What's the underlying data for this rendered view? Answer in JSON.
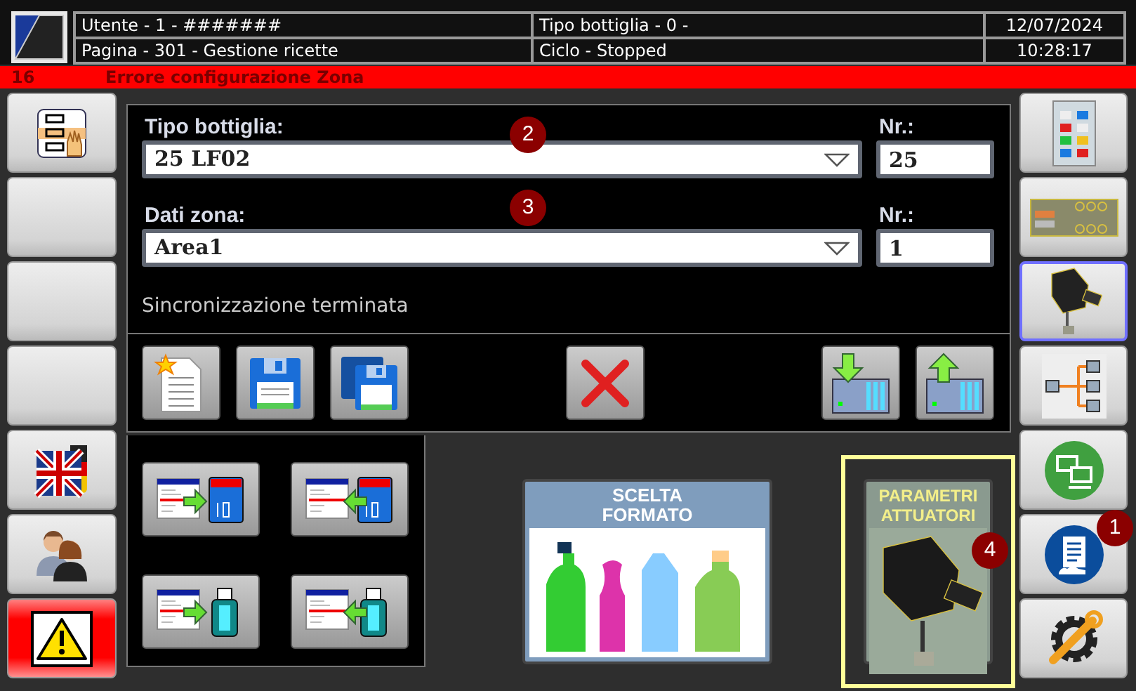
{
  "header": {
    "user": "Utente - 1 - #######",
    "bottle_type": "Tipo bottiglia - 0 -",
    "date": "12/07/2024",
    "page": "Pagina - 301 - Gestione ricette",
    "cycle": "Ciclo - Stopped",
    "time": "10:28:17"
  },
  "alarm": {
    "code": "16",
    "message": "Errore configurazione Zona"
  },
  "left_nav": [
    {
      "kind": "recipe",
      "selected": false
    },
    {
      "kind": "blank",
      "selected": false
    },
    {
      "kind": "blank",
      "selected": false
    },
    {
      "kind": "blank",
      "selected": false
    },
    {
      "kind": "language",
      "selected": false
    },
    {
      "kind": "users",
      "selected": false
    },
    {
      "kind": "alarm",
      "selected": false
    }
  ],
  "right_nav": [
    {
      "kind": "panel",
      "selected": false
    },
    {
      "kind": "board",
      "selected": false
    },
    {
      "kind": "actuator",
      "selected": true
    },
    {
      "kind": "tree",
      "selected": false
    },
    {
      "kind": "network",
      "selected": false
    },
    {
      "kind": "document",
      "selected": false,
      "badge": "1"
    },
    {
      "kind": "tools",
      "selected": false
    }
  ],
  "fields": [
    {
      "label": "Tipo bottiglia:",
      "value": "25 LF02",
      "nr_label": "Nr.:",
      "nr_value": "25",
      "badge": "2"
    },
    {
      "label": "Dati zona:",
      "value": "Area1",
      "nr_label": "Nr.:",
      "nr_value": "1",
      "badge": "3"
    }
  ],
  "status": "Sincronizzazione terminata",
  "toolbar": [
    {
      "kind": "new"
    },
    {
      "kind": "save"
    },
    {
      "kind": "save_as"
    },
    {
      "kind": "delete"
    },
    {
      "kind": "download"
    },
    {
      "kind": "upload"
    }
  ],
  "transfer": [
    {
      "kind": "to_sd"
    },
    {
      "kind": "from_sd"
    },
    {
      "kind": "to_usb"
    },
    {
      "kind": "from_usb"
    }
  ],
  "tiles": [
    {
      "kind": "bottles",
      "title": [
        "SCELTA",
        "FORMATO"
      ],
      "highlighted": false
    },
    {
      "kind": "actuator",
      "title": [
        "PARAMETRI",
        "ATTUATORI"
      ],
      "highlighted": true,
      "badge": "4"
    }
  ]
}
